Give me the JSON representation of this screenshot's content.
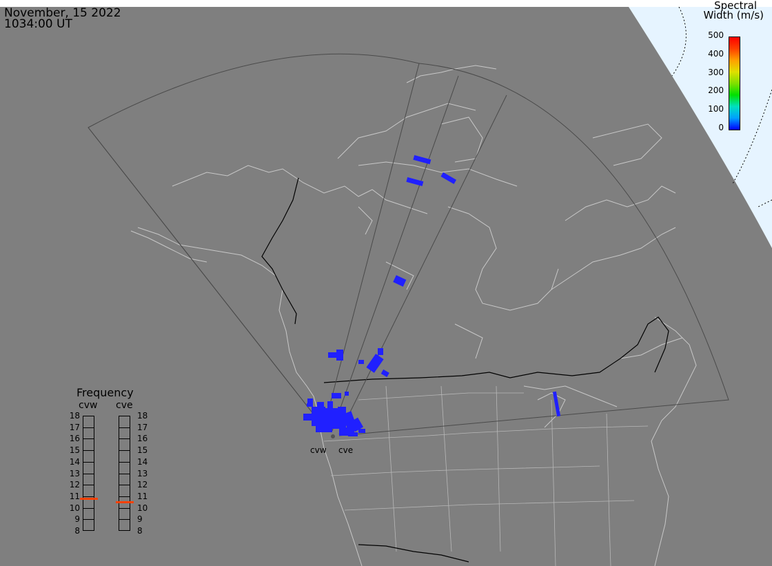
{
  "header": {
    "date": "November, 15 2022",
    "time": "1034:00 UT"
  },
  "colorbar": {
    "title_line1": "Spectral",
    "title_line2": "Width (m/s)",
    "ticks": [
      "500",
      "400",
      "300",
      "200",
      "100",
      "0"
    ],
    "range": [
      0,
      500
    ],
    "colors": [
      "#0000ff",
      "#00a0ff",
      "#00e0c0",
      "#00e000",
      "#80e000",
      "#e0e000",
      "#ffa000",
      "#ff4000",
      "#ff0000"
    ]
  },
  "frequency_panel": {
    "title": "Frequency",
    "left_label": "cvw",
    "right_label": "cve",
    "ticks": [
      "18",
      "17",
      "16",
      "15",
      "14",
      "13",
      "12",
      "11",
      "10",
      "9",
      "8"
    ],
    "cvw_frequency": 10.8,
    "cve_frequency": 10.5,
    "marker_color": "#ff4000"
  },
  "radars": {
    "west_label": "cvw",
    "east_label": "cve"
  },
  "map_colors": {
    "background": "#7f7f7f",
    "daylight": "#e6f4ff",
    "coastline": "#c8c8c8",
    "border": "#000000",
    "fov": "#4a4a4a",
    "scatter": "#2020ff"
  }
}
